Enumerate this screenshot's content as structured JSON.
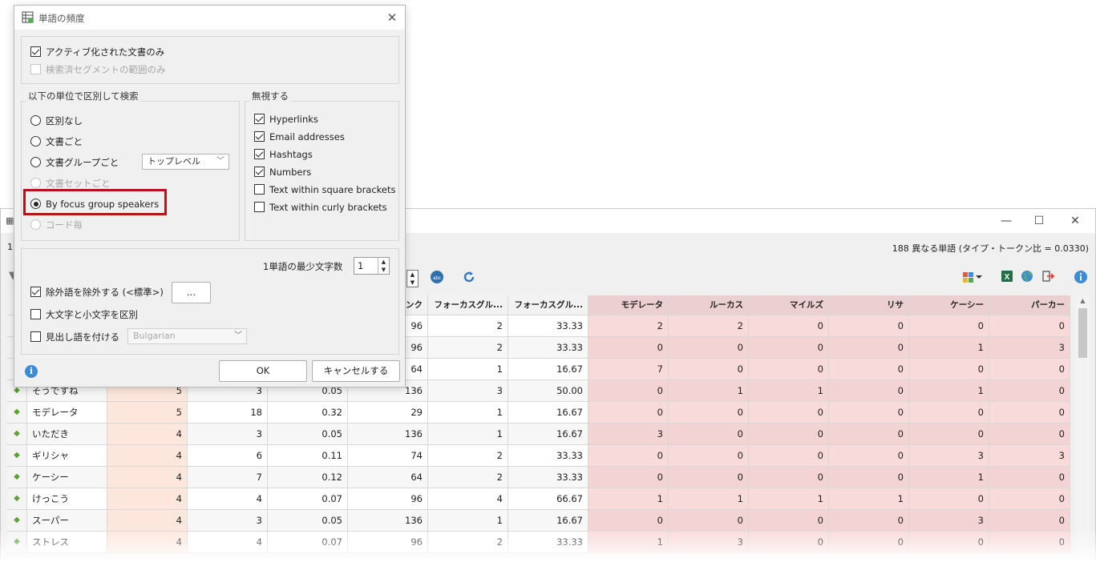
{
  "background_window": {
    "info_left": "1",
    "info_right": "188 異なる単語 (タイプ・トークン比 = 0.0330)",
    "controls": {
      "minimize": "—",
      "maximize": "☐",
      "close": "✕"
    },
    "toolbar_icons": [
      "spell-check-icon",
      "refresh-icon",
      "chart-dropdown-icon",
      "excel-icon",
      "globe-icon",
      "export-icon",
      "info-icon"
    ],
    "grid": {
      "headers": [
        "",
        "",
        "",
        "",
        "",
        "ランク",
        "フォーカスグル...",
        "フォーカスグル...",
        "モデレータ",
        "ルーカス",
        "マイルズ",
        "リサ",
        "ケーシー",
        "パーカー"
      ],
      "rows": [
        [
          "",
          "",
          "",
          "",
          "",
          "96",
          "2",
          "33.33",
          "2",
          "2",
          "0",
          "0",
          "0",
          "0"
        ],
        [
          "",
          "",
          "",
          "",
          "",
          "96",
          "2",
          "33.33",
          "0",
          "0",
          "0",
          "0",
          "1",
          "3"
        ],
        [
          "",
          "",
          "",
          "",
          "",
          "64",
          "1",
          "16.67",
          "7",
          "0",
          "0",
          "0",
          "0",
          "0"
        ],
        [
          "◆",
          "そうですね",
          "5",
          "3",
          "0.05",
          "136",
          "3",
          "50.00",
          "0",
          "1",
          "1",
          "0",
          "1",
          "0"
        ],
        [
          "◆",
          "モデレータ",
          "5",
          "18",
          "0.32",
          "29",
          "1",
          "16.67",
          "0",
          "0",
          "0",
          "0",
          "0",
          "0"
        ],
        [
          "◆",
          "いただき",
          "4",
          "3",
          "0.05",
          "136",
          "1",
          "16.67",
          "3",
          "0",
          "0",
          "0",
          "0",
          "0"
        ],
        [
          "◆",
          "ギリシャ",
          "4",
          "6",
          "0.11",
          "74",
          "2",
          "33.33",
          "0",
          "0",
          "0",
          "0",
          "3",
          "3"
        ],
        [
          "◆",
          "ケーシー",
          "4",
          "7",
          "0.12",
          "64",
          "2",
          "33.33",
          "0",
          "0",
          "0",
          "0",
          "1",
          "0"
        ],
        [
          "◆",
          "けっこう",
          "4",
          "4",
          "0.07",
          "96",
          "4",
          "66.67",
          "1",
          "1",
          "1",
          "1",
          "0",
          "0"
        ],
        [
          "◆",
          "スーパー",
          "4",
          "3",
          "0.05",
          "136",
          "1",
          "16.67",
          "0",
          "0",
          "0",
          "0",
          "3",
          "0"
        ],
        [
          "◆",
          "ストレス",
          "4",
          "4",
          "0.07",
          "96",
          "2",
          "33.33",
          "1",
          "3",
          "0",
          "0",
          "0",
          "0"
        ]
      ]
    }
  },
  "dialog": {
    "title": "単語の頻度",
    "top_options": [
      {
        "label": "アクティブ化された文書のみ",
        "checked": true,
        "disabled": false
      },
      {
        "label": "検索済セグメントの範囲のみ",
        "checked": false,
        "disabled": true
      }
    ],
    "group_unit": {
      "legend": "以下の単位で区別して検索",
      "options": [
        {
          "label": "区別なし",
          "selected": false,
          "disabled": false
        },
        {
          "label": "文書ごと",
          "selected": false,
          "disabled": false
        },
        {
          "label": "文書グループごと",
          "selected": false,
          "disabled": false
        },
        {
          "label": "文書セットごと",
          "selected": false,
          "disabled": true
        },
        {
          "label": "By focus group speakers",
          "selected": true,
          "disabled": false
        },
        {
          "label": "コード毎",
          "selected": false,
          "disabled": true
        }
      ],
      "group_level_combo": "トップレベル"
    },
    "group_ignore": {
      "legend": "無視する",
      "options": [
        {
          "label": "Hyperlinks",
          "checked": true
        },
        {
          "label": "Email addresses",
          "checked": true
        },
        {
          "label": "Hashtags",
          "checked": true
        },
        {
          "label": "Numbers",
          "checked": true
        },
        {
          "label": "Text within square brackets",
          "checked": false
        },
        {
          "label": "Text within curly brackets",
          "checked": false
        }
      ]
    },
    "min_chars_label": "1単語の最少文字数",
    "min_chars_value": "1",
    "stopwords_label": "除外語を除外する (<標準>)",
    "stopwords_checked": true,
    "stopwords_button": "...",
    "case_label": "大文字と小文字を区別",
    "case_checked": false,
    "lemma_label": "見出し語を付ける",
    "lemma_checked": false,
    "lemma_language": "Bulgarian",
    "ok": "OK",
    "cancel": "キャンセルする"
  }
}
